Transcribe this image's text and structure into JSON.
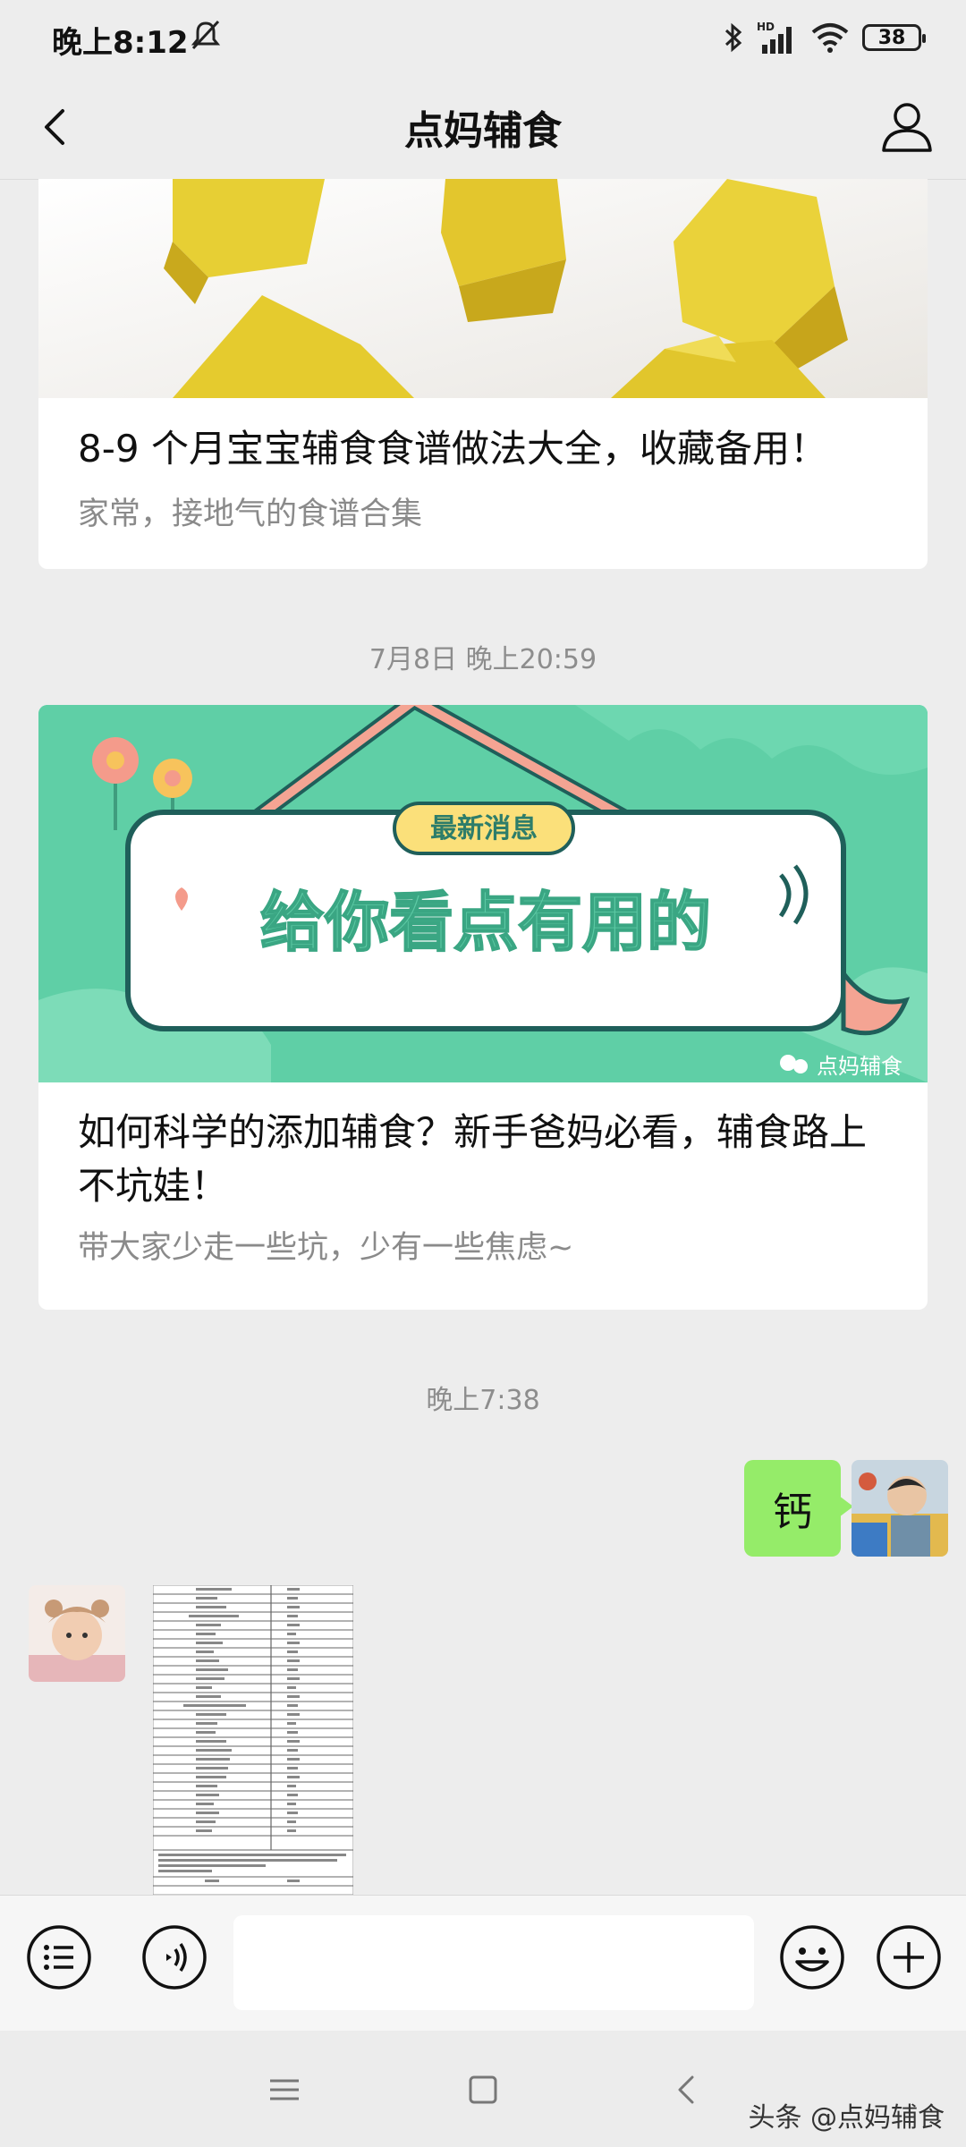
{
  "status_bar": {
    "time": "晚上8:12",
    "battery": "38",
    "icons": [
      "mute-icon",
      "bluetooth-icon",
      "hd-signal-icon",
      "wifi-icon",
      "battery-icon"
    ]
  },
  "nav": {
    "title": "点妈辅食",
    "icons": [
      "back-icon",
      "profile-icon"
    ]
  },
  "chat": {
    "cards": [
      {
        "title": "8-9 个月宝宝辅食食谱做法大全，收藏备用！",
        "desc": "家常，接地气的食谱合集"
      },
      {
        "title": "如何科学的添加辅食？新手爸妈必看，辅食路上不坑娃！",
        "desc": "带大家少走一些坑，少有一些焦虑~"
      }
    ],
    "timestamps": [
      "7月8日 晚上20:59",
      "晚上7:38"
    ],
    "banner": {
      "tag": "最新消息",
      "headline": "给你看点有用的",
      "brand": "点妈辅食"
    },
    "my_message": "钙"
  },
  "input_bar": {
    "icons": [
      "menu-list-icon",
      "voice-icon",
      "emoji-icon",
      "plus-icon"
    ]
  },
  "system_nav": {
    "icons": [
      "recent-apps-icon",
      "home-icon",
      "back-nav-icon"
    ],
    "watermark": "头条 @点妈辅食"
  },
  "colors": {
    "bubble_green": "#95ec69",
    "background": "#ededed",
    "banner_teal": "#5fcfa6"
  }
}
